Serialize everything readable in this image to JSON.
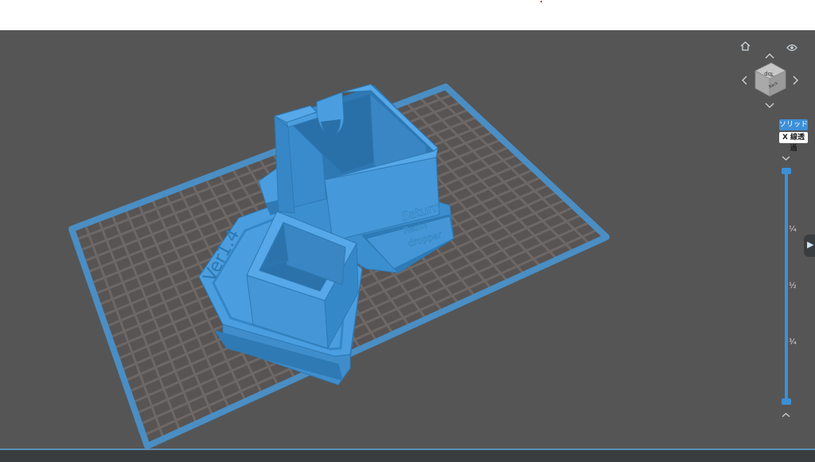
{
  "viewport": {
    "background_color": "#555555",
    "grid_color": "#6b6665",
    "plate_border_color": "#4a8ec4",
    "model_color": "#3f93d3"
  },
  "model": {
    "label_version": "Ver1.4",
    "label_saturn": "Saturn",
    "label_resin": "Resin",
    "label_dropper": "dropper"
  },
  "view_cube": {
    "top_label": "Top",
    "back_label": "Back"
  },
  "toolbar": {
    "solid_label": "ソリッド",
    "xray_label": "X 線透過"
  },
  "layer_slider": {
    "tick_quarter": "¼",
    "tick_half": "½",
    "tick_three_quarter": "¾"
  },
  "icons": {
    "home": "home-icon",
    "eye": "eye-icon",
    "nav_up": "arrow-up-icon",
    "nav_down": "arrow-down-icon",
    "nav_left": "arrow-left-icon",
    "nav_right": "arrow-right-icon",
    "chevron_down": "chevron-down-icon",
    "chevron_up": "chevron-up-icon",
    "panel_toggle": "chevron-right-icon"
  }
}
